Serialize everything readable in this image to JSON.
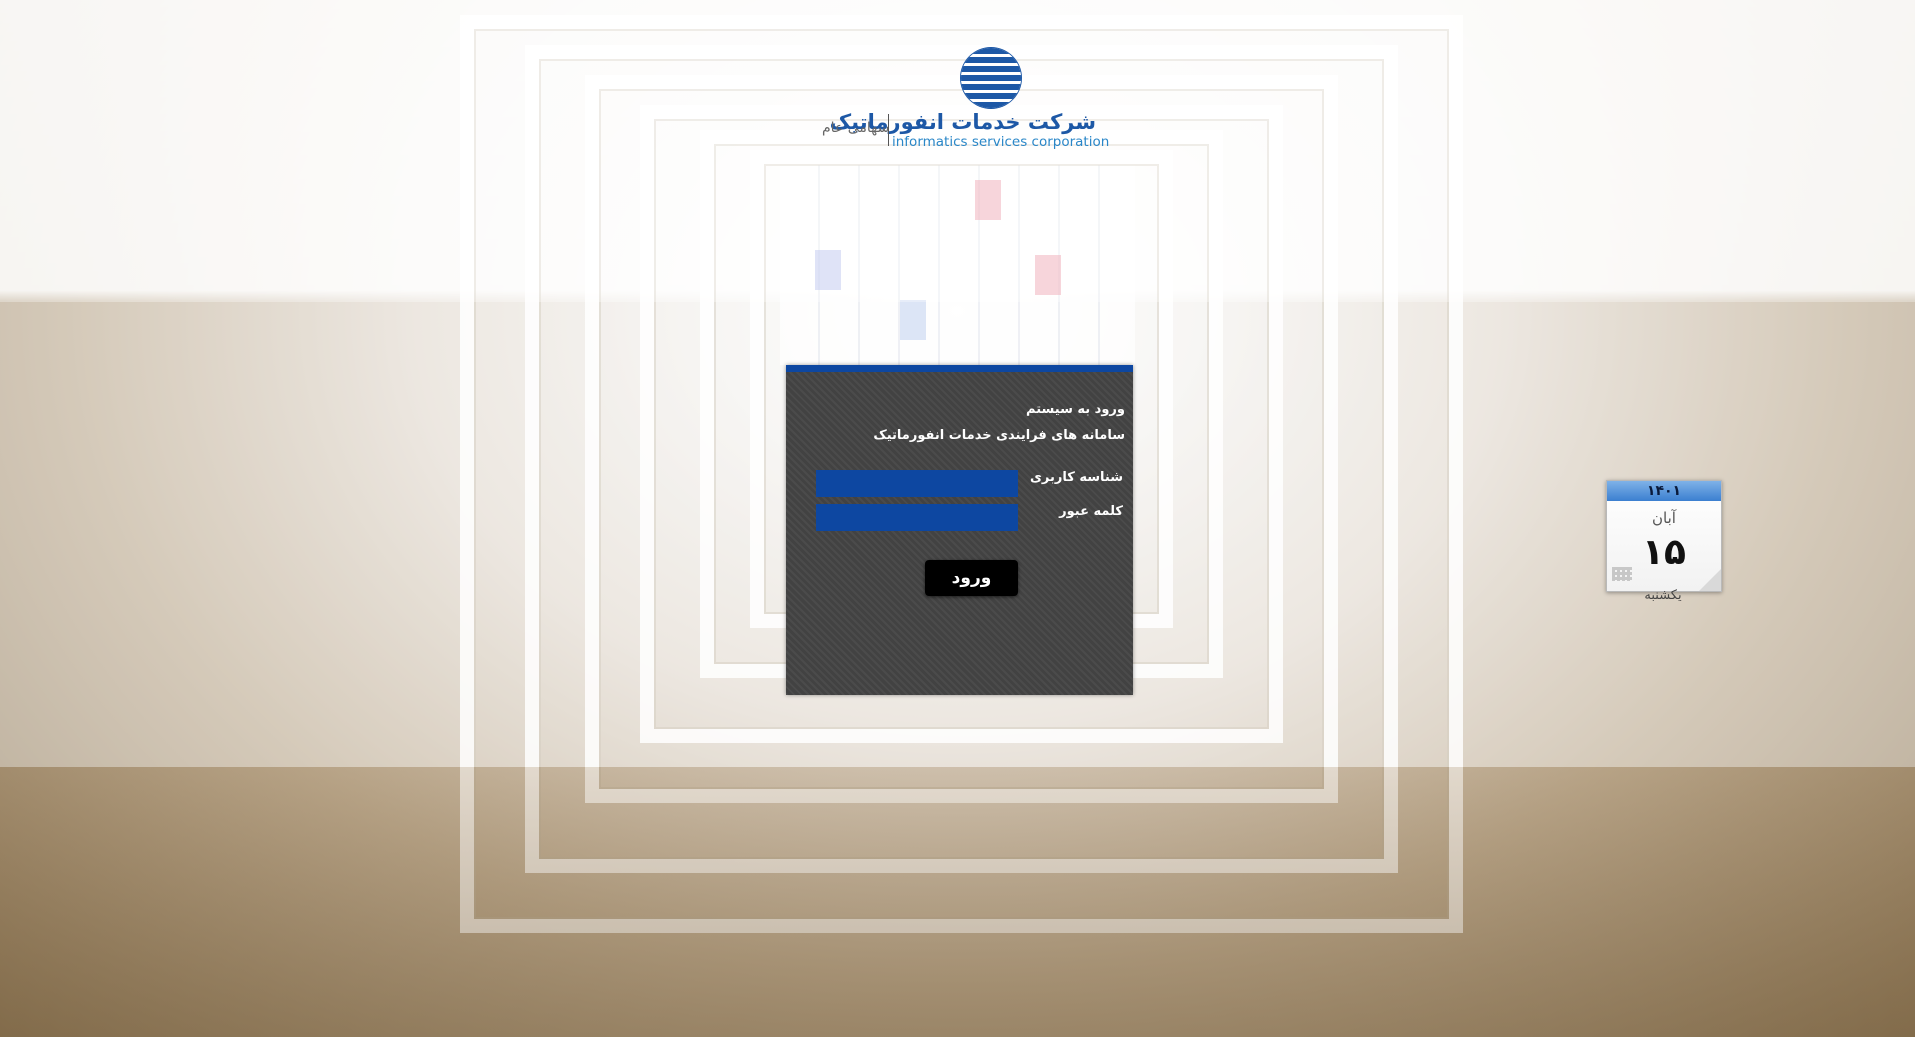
{
  "logo": {
    "company_fa": "شرکت خدمات انفورماتیک",
    "company_en": "informatics services corporation",
    "company_type": "سهامی عام"
  },
  "login": {
    "title": "ورود به سیستم",
    "subtitle": "سامانه های فرایندی خدمات انفورماتیک",
    "username_label": "شناسه کاربری",
    "username_value": "",
    "password_label": "کلمه عبور",
    "password_value": "",
    "submit_label": "ورود"
  },
  "calendar": {
    "year": "۱۴۰۱",
    "month": "آبان",
    "day": "۱۵",
    "weekday": "یکشنبه"
  },
  "colors": {
    "accent": "#0d47a1",
    "panel_bg": "#464646",
    "button_bg": "#000000"
  }
}
